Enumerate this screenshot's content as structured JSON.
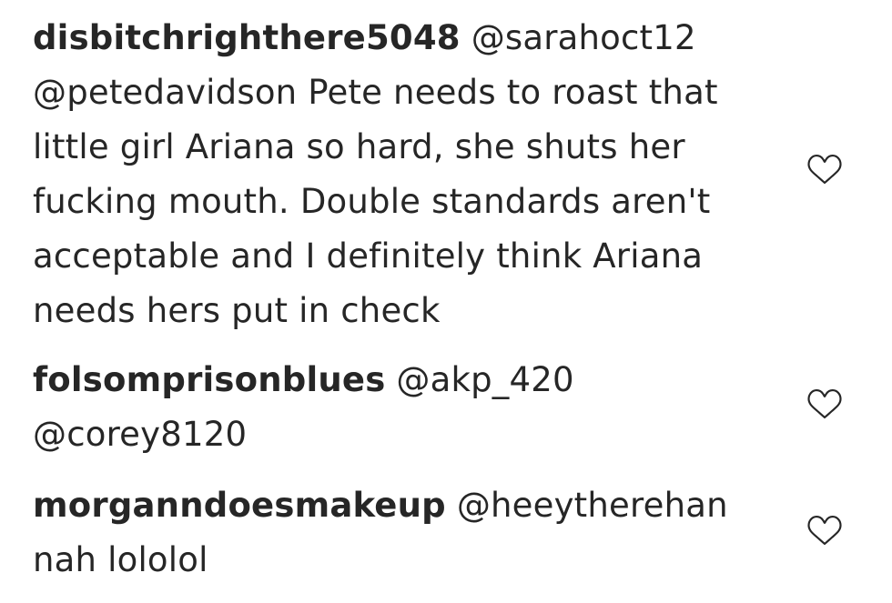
{
  "comments": [
    {
      "username": "disbitchrighthere5048",
      "text": "@sarahoct12 @petedavidson Pete needs to roast that little girl Ariana so hard, she shuts her fucking mouth. Double standards aren't acceptable and I definitely think Ariana needs hers put in check",
      "like_icon": "heart-outline-icon"
    },
    {
      "username": "folsomprisonblues",
      "text": "@akp_420 @corey8120",
      "like_icon": "heart-outline-icon"
    },
    {
      "username": "morganndoesmakeup",
      "text": "@heeytherehan nah lololol",
      "like_icon": "heart-outline-icon"
    }
  ],
  "colors": {
    "text": "#262626",
    "icon_stroke": "#262626",
    "background": "#ffffff"
  }
}
